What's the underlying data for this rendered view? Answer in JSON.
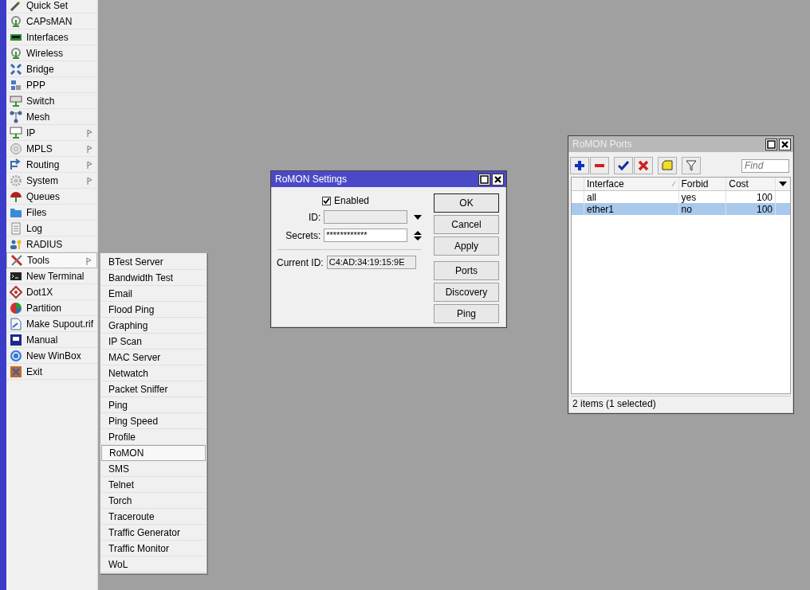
{
  "sidebar": {
    "items": [
      {
        "label": "Quick Set",
        "submenu": false,
        "selected": false
      },
      {
        "label": "CAPsMAN",
        "submenu": false,
        "selected": false
      },
      {
        "label": "Interfaces",
        "submenu": false,
        "selected": false
      },
      {
        "label": "Wireless",
        "submenu": false,
        "selected": false
      },
      {
        "label": "Bridge",
        "submenu": false,
        "selected": false
      },
      {
        "label": "PPP",
        "submenu": false,
        "selected": false
      },
      {
        "label": "Switch",
        "submenu": false,
        "selected": false
      },
      {
        "label": "Mesh",
        "submenu": false,
        "selected": false
      },
      {
        "label": "IP",
        "submenu": true,
        "selected": false
      },
      {
        "label": "MPLS",
        "submenu": true,
        "selected": false
      },
      {
        "label": "Routing",
        "submenu": true,
        "selected": false
      },
      {
        "label": "System",
        "submenu": true,
        "selected": false
      },
      {
        "label": "Queues",
        "submenu": false,
        "selected": false
      },
      {
        "label": "Files",
        "submenu": false,
        "selected": false
      },
      {
        "label": "Log",
        "submenu": false,
        "selected": false
      },
      {
        "label": "RADIUS",
        "submenu": false,
        "selected": false
      },
      {
        "label": "Tools",
        "submenu": true,
        "selected": true
      },
      {
        "label": "New Terminal",
        "submenu": false,
        "selected": false
      },
      {
        "label": "Dot1X",
        "submenu": false,
        "selected": false
      },
      {
        "label": "Partition",
        "submenu": false,
        "selected": false
      },
      {
        "label": "Make Supout.rif",
        "submenu": false,
        "selected": false
      },
      {
        "label": "Manual",
        "submenu": false,
        "selected": false
      },
      {
        "label": "New WinBox",
        "submenu": false,
        "selected": false
      },
      {
        "label": "Exit",
        "submenu": false,
        "selected": false
      }
    ]
  },
  "tools_menu": {
    "items": [
      {
        "label": "BTest Server",
        "selected": false
      },
      {
        "label": "Bandwidth Test",
        "selected": false
      },
      {
        "label": "Email",
        "selected": false
      },
      {
        "label": "Flood Ping",
        "selected": false
      },
      {
        "label": "Graphing",
        "selected": false
      },
      {
        "label": "IP Scan",
        "selected": false
      },
      {
        "label": "MAC Server",
        "selected": false
      },
      {
        "label": "Netwatch",
        "selected": false
      },
      {
        "label": "Packet Sniffer",
        "selected": false
      },
      {
        "label": "Ping",
        "selected": false
      },
      {
        "label": "Ping Speed",
        "selected": false
      },
      {
        "label": "Profile",
        "selected": false
      },
      {
        "label": "RoMON",
        "selected": true
      },
      {
        "label": "SMS",
        "selected": false
      },
      {
        "label": "Telnet",
        "selected": false
      },
      {
        "label": "Torch",
        "selected": false
      },
      {
        "label": "Traceroute",
        "selected": false
      },
      {
        "label": "Traffic Generator",
        "selected": false
      },
      {
        "label": "Traffic Monitor",
        "selected": false
      },
      {
        "label": "WoL",
        "selected": false
      }
    ]
  },
  "settings_window": {
    "title": "RoMON Settings",
    "active": true,
    "enabled": {
      "label": "Enabled",
      "checked": true
    },
    "id": {
      "label": "ID:"
    },
    "secrets": {
      "label": "Secrets:",
      "value": "************"
    },
    "current_id": {
      "label": "Current ID:",
      "value": "C4:AD:34:19:15:9E"
    },
    "buttons": [
      {
        "label": "OK",
        "default": true
      },
      {
        "label": "Cancel",
        "default": false
      },
      {
        "label": "Apply",
        "default": false
      },
      {
        "label": "Ports",
        "default": false
      },
      {
        "label": "Discovery",
        "default": false
      },
      {
        "label": "Ping",
        "default": false
      }
    ]
  },
  "ports_window": {
    "title": "RoMON Ports",
    "active": false,
    "find": {
      "placeholder": "Find"
    },
    "columns": [
      "Interface",
      "Forbid",
      "Cost"
    ],
    "rows": [
      {
        "interface": "all",
        "forbid": "yes",
        "cost": "100",
        "selected": false
      },
      {
        "interface": "ether1",
        "forbid": "no",
        "cost": "100",
        "selected": true
      }
    ],
    "status": "2 items (1 selected)"
  }
}
